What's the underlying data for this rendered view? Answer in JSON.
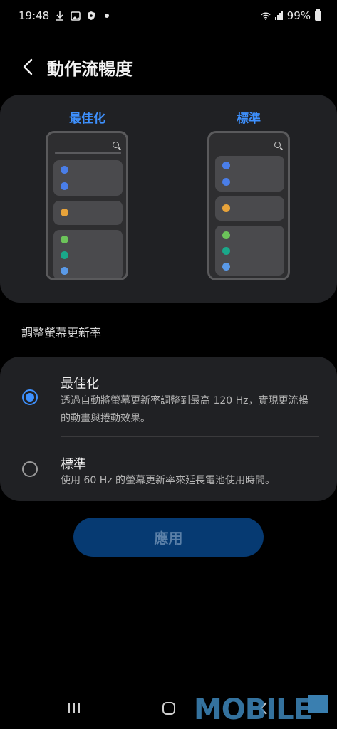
{
  "status_bar": {
    "time": "19:48",
    "battery_percent": "99%",
    "left_icons": [
      "download-icon",
      "image-icon",
      "shield-icon",
      "dot-icon"
    ],
    "right_icons": [
      "wifi-icon",
      "signal-icon",
      "battery-icon"
    ]
  },
  "header": {
    "title": "動作流暢度"
  },
  "preview": {
    "optimized_label": "最佳化",
    "standard_label": "標準"
  },
  "section": {
    "label": "調整螢幕更新率"
  },
  "options": [
    {
      "title": "最佳化",
      "description": "透過自動將螢幕更新率調整到最高 120 Hz，實現更流暢的動畫與捲動效果。",
      "selected": true
    },
    {
      "title": "標準",
      "description": "使用 60 Hz 的螢幕更新率來延長電池使用時間。",
      "selected": false
    }
  ],
  "apply_button": {
    "label": "應用"
  },
  "nav": {
    "icons": [
      "recents-icon",
      "home-icon",
      "back-icon"
    ]
  },
  "watermark": {
    "text": "MOBILE"
  },
  "colors": {
    "accent": "#3e91ff",
    "card": "#202124",
    "button_bg": "#063a72",
    "dot_blue": "#4a7ee8",
    "dot_orange": "#e8a33a",
    "dot_green": "#6cc35a",
    "dot_teal": "#1aa88a",
    "dot_lightblue": "#5a9ae8"
  }
}
